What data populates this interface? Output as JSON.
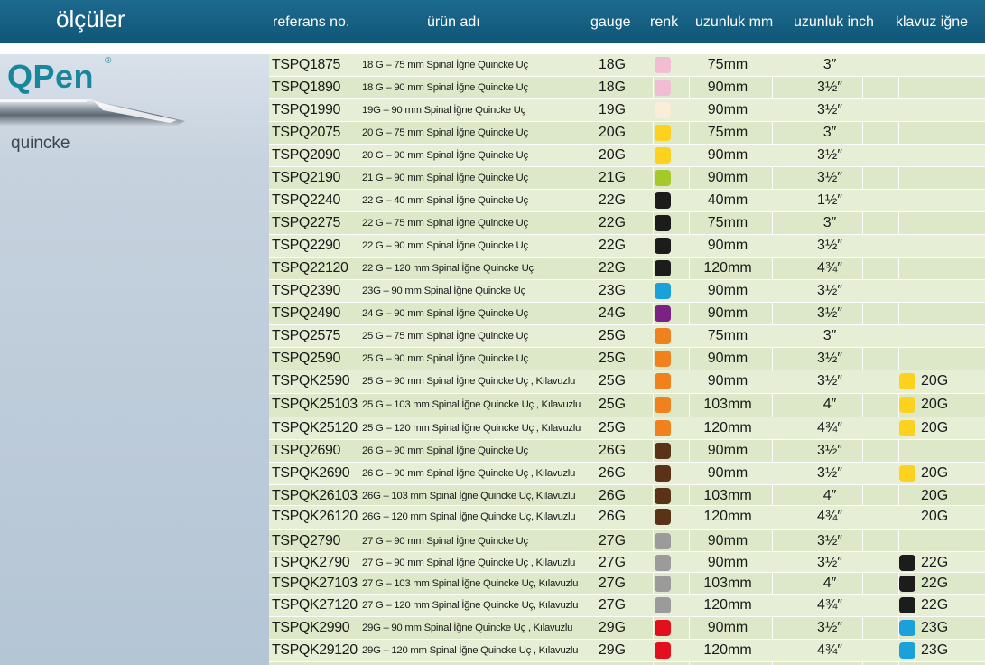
{
  "header": {
    "section_title": "ölçüler",
    "columns": {
      "ref": "referans no.",
      "name": "ürün adı",
      "gauge": "gauge",
      "color": "renk",
      "length_mm": "uzunluk mm",
      "length_inch": "uzunluk inch",
      "guide": "klavuz iğne"
    }
  },
  "sidebar": {
    "brand": "QPen",
    "brand_mark": "®",
    "subtitle": "quincke"
  },
  "colors": {
    "pink": "#f0bdd3",
    "cream": "#fbeed8",
    "yellow": "#fdd21f",
    "lime": "#a6c82a",
    "black": "#1c1c1c",
    "blue": "#1aa1dc",
    "purple": "#7b2385",
    "orange": "#f0821e",
    "brown": "#5a3217",
    "gray": "#9b9b9b",
    "red": "#e2101c"
  },
  "rows": [
    {
      "ref": "TSPQ1875",
      "name": "18 G – 75 mm Spinal İğne Quincke Uç",
      "gauge": "18G",
      "color": "#f0bdd3",
      "mm": "75mm",
      "inch": "3″",
      "guide_color": "",
      "guide": ""
    },
    {
      "ref": "TSPQ1890",
      "name": "18 G – 90 mm Spinal İğne Quincke Uç",
      "gauge": "18G",
      "color": "#f0bdd3",
      "mm": "90mm",
      "inch": "3½″",
      "guide_color": "",
      "guide": ""
    },
    {
      "ref": "TSPQ1990",
      "name": "19G – 90 mm Spinal İğne Quincke Uç",
      "gauge": "19G",
      "color": "#fbeed8",
      "mm": "90mm",
      "inch": "3½″",
      "guide_color": "",
      "guide": ""
    },
    {
      "ref": "TSPQ2075",
      "name": "20 G – 75 mm Spinal İğne Quincke Uç",
      "gauge": "20G",
      "color": "#fdd21f",
      "mm": "75mm",
      "inch": "3″",
      "guide_color": "",
      "guide": ""
    },
    {
      "ref": "TSPQ2090",
      "name": "20 G – 90 mm Spinal İğne Quincke Uç",
      "gauge": "20G",
      "color": "#fdd21f",
      "mm": "90mm",
      "inch": "3½″",
      "guide_color": "",
      "guide": ""
    },
    {
      "ref": "TSPQ2190",
      "name": "21 G – 90 mm Spinal İğne Quincke Uç",
      "gauge": "21G",
      "color": "#a6c82a",
      "mm": "90mm",
      "inch": "3½″",
      "guide_color": "",
      "guide": ""
    },
    {
      "ref": "TSPQ2240",
      "name": "22 G – 40 mm Spinal İğne Quincke Uç",
      "gauge": "22G",
      "color": "#1c1c1c",
      "mm": "40mm",
      "inch": "1½″",
      "guide_color": "",
      "guide": ""
    },
    {
      "ref": "TSPQ2275",
      "name": "22 G – 75 mm Spinal İğne Quincke Uç",
      "gauge": "22G",
      "color": "#1c1c1c",
      "mm": "75mm",
      "inch": "3″",
      "guide_color": "",
      "guide": ""
    },
    {
      "ref": "TSPQ2290",
      "name": "22 G – 90 mm Spinal İğne Quincke Uç",
      "gauge": "22G",
      "color": "#1c1c1c",
      "mm": "90mm",
      "inch": "3½″",
      "guide_color": "",
      "guide": ""
    },
    {
      "ref": "TSPQ22120",
      "name": "22 G – 120 mm Spinal İğne Quincke Uç",
      "gauge": "22G",
      "color": "#1c1c1c",
      "mm": "120mm",
      "inch": "4¾″",
      "guide_color": "",
      "guide": ""
    },
    {
      "ref": "TSPQ2390",
      "name": "23G – 90 mm Spinal İğne Quincke Uç",
      "gauge": "23G",
      "color": "#1aa1dc",
      "mm": "90mm",
      "inch": "3½″",
      "guide_color": "",
      "guide": ""
    },
    {
      "ref": "TSPQ2490",
      "name": "24 G – 90 mm Spinal İğne Quincke Uç",
      "gauge": "24G",
      "color": "#7b2385",
      "mm": "90mm",
      "inch": "3½″",
      "guide_color": "",
      "guide": ""
    },
    {
      "ref": "TSPQ2575",
      "name": "25 G – 75 mm Spinal İğne Quincke Uç",
      "gauge": "25G",
      "color": "#f0821e",
      "mm": "75mm",
      "inch": "3″",
      "guide_color": "",
      "guide": ""
    },
    {
      "ref": "TSPQ2590",
      "name": "25 G – 90 mm Spinal İğne Quincke Uç",
      "gauge": "25G",
      "color": "#f0821e",
      "mm": "90mm",
      "inch": "3½″",
      "guide_color": "",
      "guide": ""
    },
    {
      "ref": "TSPQK2590",
      "name": "25 G – 90 mm Spinal İğne Quincke Uç , Kılavuzlu",
      "gauge": "25G",
      "color": "#f0821e",
      "mm": "90mm",
      "inch": "3½″",
      "guide_color": "#fdd21f",
      "guide": "20G"
    },
    {
      "ref": "TSPQK25103",
      "name": "25 G – 103 mm Spinal İğne Quincke Uç , Kılavuzlu",
      "gauge": "25G",
      "color": "#f0821e",
      "mm": "103mm",
      "inch": "4″",
      "guide_color": "#fdd21f",
      "guide": "20G"
    },
    {
      "ref": "TSPQK25120",
      "name": "25 G – 120 mm Spinal İğne Quincke Uç , Kılavuzlu",
      "gauge": "25G",
      "color": "#f0821e",
      "mm": "120mm",
      "inch": "4¾″",
      "guide_color": "#fdd21f",
      "guide": "20G"
    },
    {
      "ref": "TSPQ2690",
      "name": "26 G – 90 mm Spinal İğne Quincke Uç",
      "gauge": "26G",
      "color": "#5a3217",
      "mm": "90mm",
      "inch": "3½″",
      "guide_color": "",
      "guide": ""
    },
    {
      "ref": "TSPQK2690",
      "name": "26 G – 90 mm Spinal İğne Quincke Uç , Kılavuzlu",
      "gauge": "26G",
      "color": "#5a3217",
      "mm": "90mm",
      "inch": "3½″",
      "guide_color": "#fdd21f",
      "guide": "20G"
    },
    {
      "ref": "TSPQK26103",
      "name": "26G – 103 mm Spinal İğne Quincke Uç, Kılavuzlu",
      "gauge": "26G",
      "color": "#5a3217",
      "mm": "103mm",
      "inch": "4″",
      "guide_color": "",
      "guide": "20G"
    },
    {
      "ref": "TSPQK26120",
      "name": "26G – 120 mm Spinal İğne Quincke Uç, Kılavuzlu",
      "gauge": "26G",
      "color": "#5a3217",
      "mm": "120mm",
      "inch": "4¾″",
      "guide_color": "",
      "guide": "20G"
    },
    {
      "ref": "TSPQ2790",
      "name": "27 G – 90 mm Spinal İğne Quincke Uç",
      "gauge": "27G",
      "color": "#9b9b9b",
      "mm": "90mm",
      "inch": "3½″",
      "guide_color": "",
      "guide": ""
    },
    {
      "ref": "TSPQK2790",
      "name": "27 G – 90 mm Spinal İğne Quincke Uç , Kılavuzlu",
      "gauge": "27G",
      "color": "#9b9b9b",
      "mm": "90mm",
      "inch": "3½″",
      "guide_color": "#1c1c1c",
      "guide": "22G"
    },
    {
      "ref": "TSPQK27103",
      "name": "27 G – 103 mm Spinal İğne Quincke Uç, Kılavuzlu",
      "gauge": "27G",
      "color": "#9b9b9b",
      "mm": "103mm",
      "inch": "4″",
      "guide_color": "#1c1c1c",
      "guide": "22G"
    },
    {
      "ref": "TSPQK27120",
      "name": "27 G – 120 mm Spinal İğne Quincke Uç, Kılavuzlu",
      "gauge": "27G",
      "color": "#9b9b9b",
      "mm": "120mm",
      "inch": "4¾″",
      "guide_color": "#1c1c1c",
      "guide": "22G"
    },
    {
      "ref": "TSPQK2990",
      "name": "29G – 90 mm Spinal İğne Quincke Uç , Kılavuzlu",
      "gauge": "29G",
      "color": "#e2101c",
      "mm": "90mm",
      "inch": "3½″",
      "guide_color": "#1aa1dc",
      "guide": "23G"
    },
    {
      "ref": "TSPQK29120",
      "name": "29G – 120 mm Spinal İğne Quincke Uç , Kılavuzlu",
      "gauge": "29G",
      "color": "#e2101c",
      "mm": "120mm",
      "inch": "4¾″",
      "guide_color": "#1aa1dc",
      "guide": "23G"
    }
  ]
}
